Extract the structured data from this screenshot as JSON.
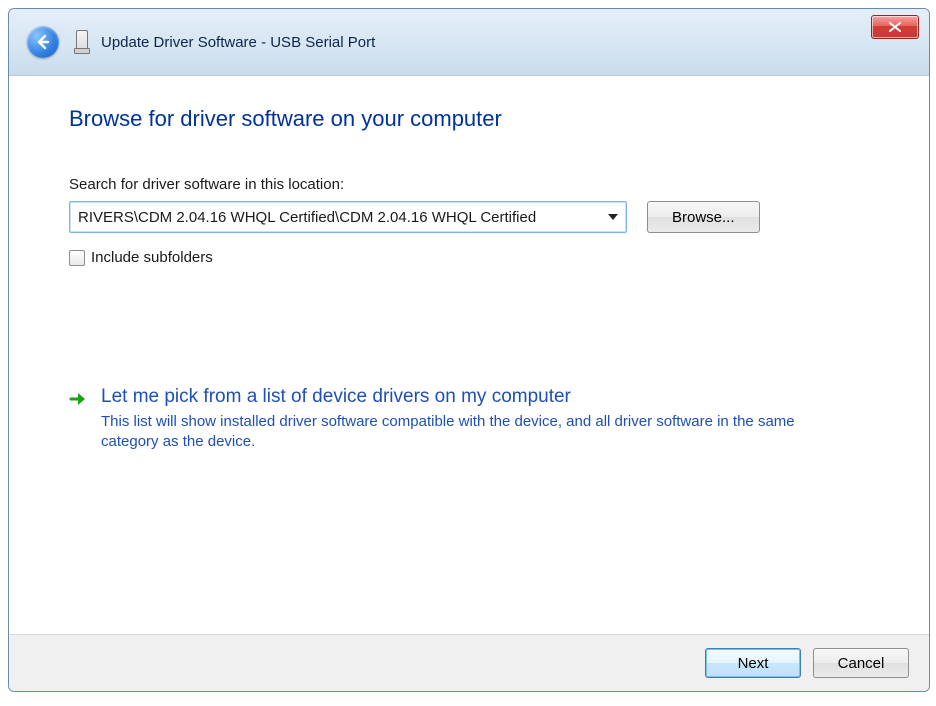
{
  "header": {
    "title": "Update Driver Software - USB Serial Port"
  },
  "main": {
    "instruction": "Browse for driver software on your computer",
    "search_label": "Search for driver software in this location:",
    "path_value": "RIVERS\\CDM 2.04.16 WHQL Certified\\CDM 2.04.16 WHQL Certified",
    "browse_label": "Browse...",
    "include_subfolders_label": "Include subfolders",
    "option": {
      "title": "Let me pick from a list of device drivers on my computer",
      "desc": "This list will show installed driver software compatible with the device, and all driver software in the same category as the device."
    }
  },
  "footer": {
    "next_label": "Next",
    "cancel_label": "Cancel"
  }
}
